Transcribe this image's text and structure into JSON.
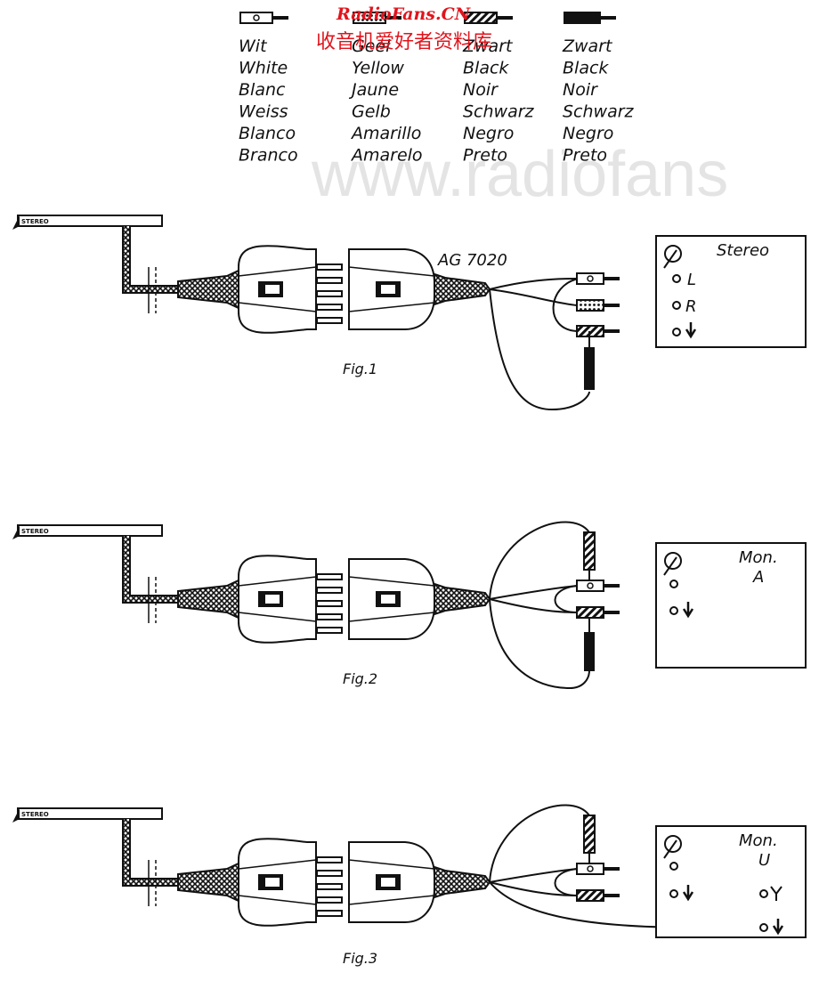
{
  "watermark": {
    "site": "RadioFans.CN",
    "chinese": "收音机爱好者资料库",
    "url": "www.radiofans"
  },
  "legend": [
    {
      "plug_style": "white-plug",
      "names": [
        "Wit",
        "White",
        "Blanc",
        "Weiss",
        "Blanco",
        "Branco"
      ]
    },
    {
      "plug_style": "yellow-plug",
      "names": [
        "Geel",
        "Yellow",
        "Jaune",
        "Gelb",
        "Amarillo",
        "Amarelo"
      ]
    },
    {
      "plug_style": "black-hatched-plug",
      "names": [
        "Zwart",
        "Black",
        "Noir",
        "Schwarz",
        "Negro",
        "Preto"
      ]
    },
    {
      "plug_style": "solid-black-plug",
      "names": [
        "Zwart",
        "Black",
        "Noir",
        "Schwarz",
        "Negro",
        "Preto"
      ]
    }
  ],
  "pickup_label": "STEREO",
  "model": "AG 7020",
  "figures": [
    {
      "caption": "Fig.1",
      "mode": "Stereo",
      "mode2": "",
      "sockets": [
        "L",
        "R"
      ]
    },
    {
      "caption": "Fig.2",
      "mode": "Mon.",
      "mode2": "A",
      "sockets": []
    },
    {
      "caption": "Fig.3",
      "mode": "Mon.",
      "mode2": "U",
      "sockets": []
    }
  ],
  "colors": {
    "ink": "#111111",
    "watermark_red": "#e0141c",
    "watermark_gray": "#e4e4e4"
  }
}
